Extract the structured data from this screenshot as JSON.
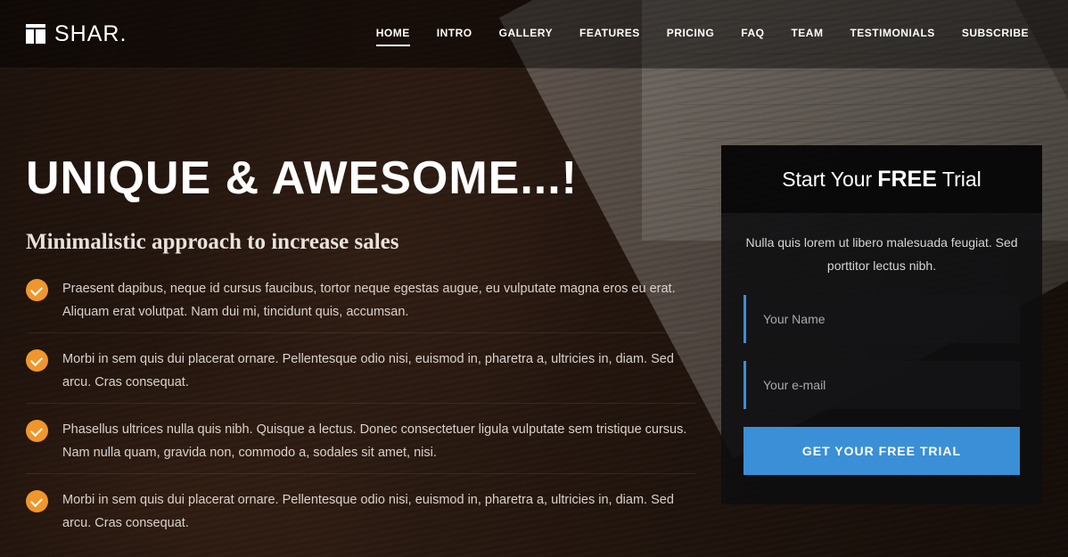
{
  "brand": {
    "name": "SHAR."
  },
  "nav": {
    "items": [
      {
        "label": "HOME",
        "active": true
      },
      {
        "label": "INTRO"
      },
      {
        "label": "GALLERY"
      },
      {
        "label": "FEATURES"
      },
      {
        "label": "PRICING"
      },
      {
        "label": "FAQ"
      },
      {
        "label": "TEAM"
      },
      {
        "label": "TESTIMONIALS"
      },
      {
        "label": "SUBSCRIBE"
      }
    ]
  },
  "hero": {
    "headline": "UNIQUE & AWESOME...!",
    "subheadline": "Minimalistic approach to increase sales",
    "features": [
      "Praesent dapibus, neque id cursus faucibus, tortor neque egestas augue, eu vulputate magna eros eu erat. Aliquam erat volutpat. Nam dui mi, tincidunt quis, accumsan.",
      "Morbi in sem quis dui placerat ornare. Pellentesque odio nisi, euismod in, pharetra a, ultricies in, diam. Sed arcu. Cras consequat.",
      "Phasellus ultrices nulla quis nibh. Quisque a lectus. Donec consectetuer ligula vulputate sem tristique cursus. Nam nulla quam, gravida non, commodo a, sodales sit amet, nisi.",
      "Morbi in sem quis dui placerat ornare. Pellentesque odio nisi, euismod in, pharetra a, ultricies in, diam. Sed arcu. Cras consequat."
    ],
    "feature_icon": "check-circle-icon",
    "accent_color": "#f0962c"
  },
  "trial": {
    "title_start": "Start Your",
    "title_bold": "FREE",
    "title_end": "Trial",
    "description": "Nulla quis lorem ut libero malesuada feugiat. Sed porttitor lectus nibh.",
    "name_placeholder": "Your Name",
    "email_placeholder": "Your e-mail",
    "cta_label": "GET YOUR FREE TRIAL",
    "cta_color": "#3a8fd6"
  }
}
